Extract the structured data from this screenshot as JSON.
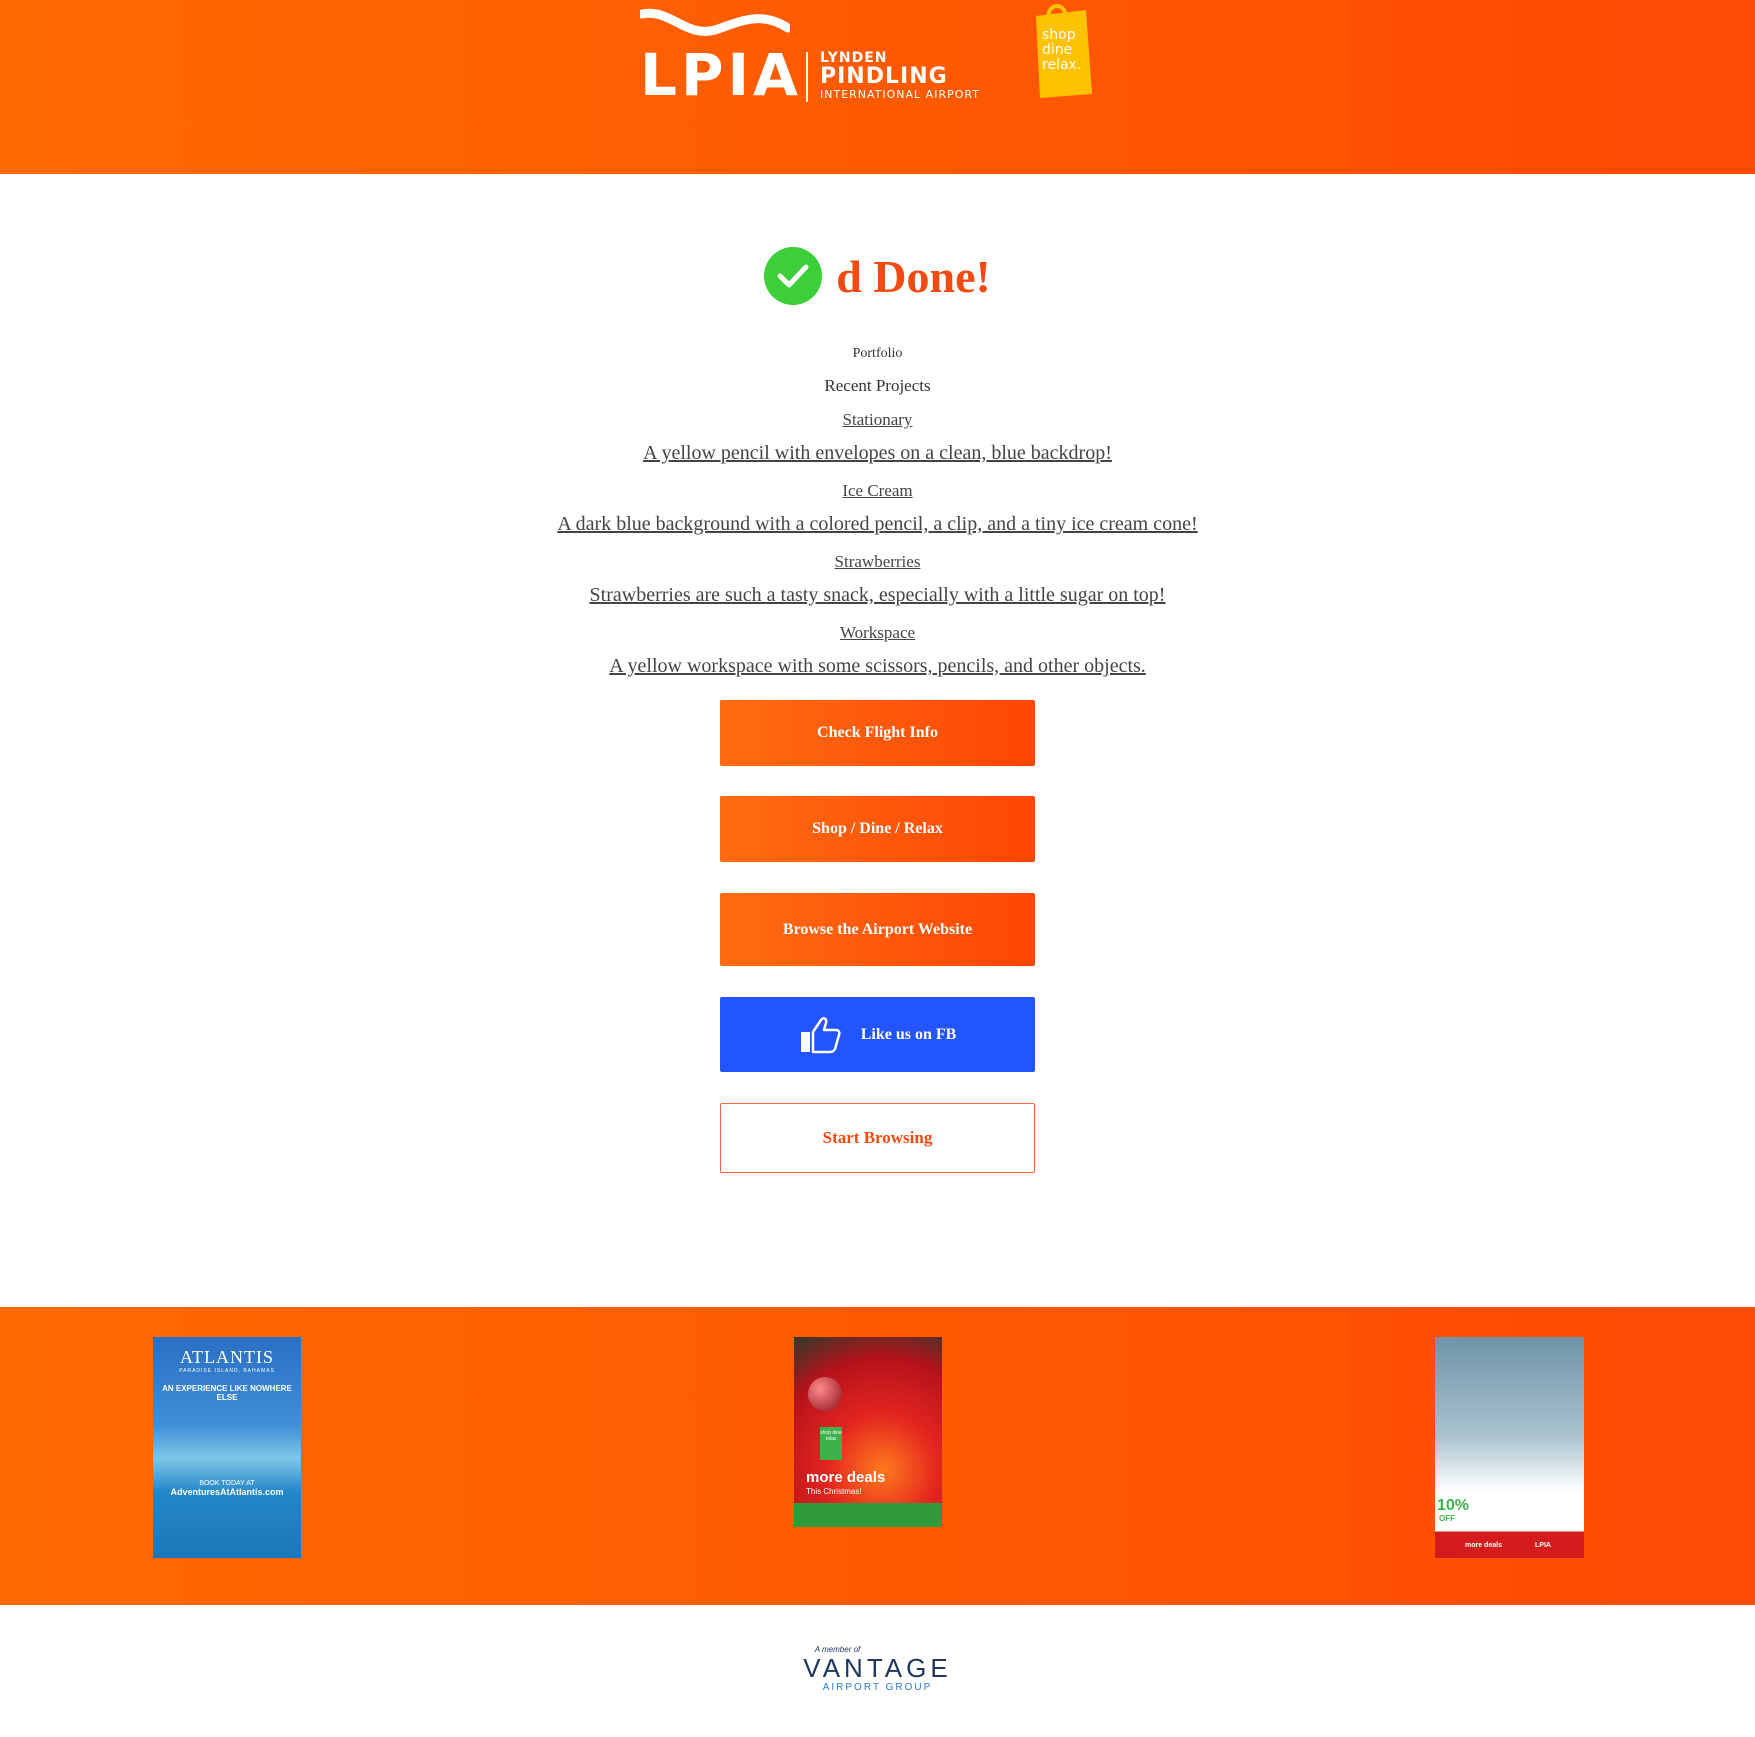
{
  "header": {
    "logo_text": "LPIA",
    "logo_sub1": "LYNDEN",
    "logo_sub2": "PINDLING",
    "logo_sub3": "INTERNATIONAL AIRPORT",
    "shop_bag_text": [
      "shop",
      "dine",
      "relax."
    ]
  },
  "main": {
    "done_title": "d Done!",
    "portfolio_label": "Portfolio",
    "recent_label": "Recent Projects",
    "projects": [
      {
        "title": "Stationary",
        "description": "A yellow pencil with envelopes on a clean, blue backdrop!"
      },
      {
        "title": "Ice Cream",
        "description": "A dark blue background with a colored pencil, a clip, and a tiny ice cream cone!"
      },
      {
        "title": "Strawberries",
        "description": "Strawberries are such a tasty snack, especially with a little sugar on top!"
      },
      {
        "title": "Workspace",
        "description": "A yellow workspace with some scissors, pencils, and other objects."
      }
    ],
    "buttons": {
      "check_flight": "Check Flight Info",
      "shop_dine_relax": "Shop / Dine / Relax",
      "browse_airport": "Browse the Airport Website",
      "like_fb": "Like us on FB",
      "start_browsing": "Start Browsing"
    }
  },
  "ads": {
    "atlantis": {
      "brand": "ATLANTIS",
      "location": "PARADISE ISLAND, BAHAMAS",
      "tagline": "AN EXPERIENCE LIKE NOWHERE ELSE",
      "cta": "BOOK TODAY AT",
      "url": "AdventuresAtAtlantis.com"
    },
    "christmas": {
      "badge": "shop dine relax",
      "headline": "more deals",
      "subline": "This Christmas!"
    },
    "quiznos": {
      "percent": "10%",
      "off": "OFF",
      "footer_left": "more deals",
      "footer_right": "LPIA"
    }
  },
  "footer": {
    "member_of": "A member of",
    "brand": "VANTAGE",
    "sub": "AIRPORT GROUP"
  }
}
